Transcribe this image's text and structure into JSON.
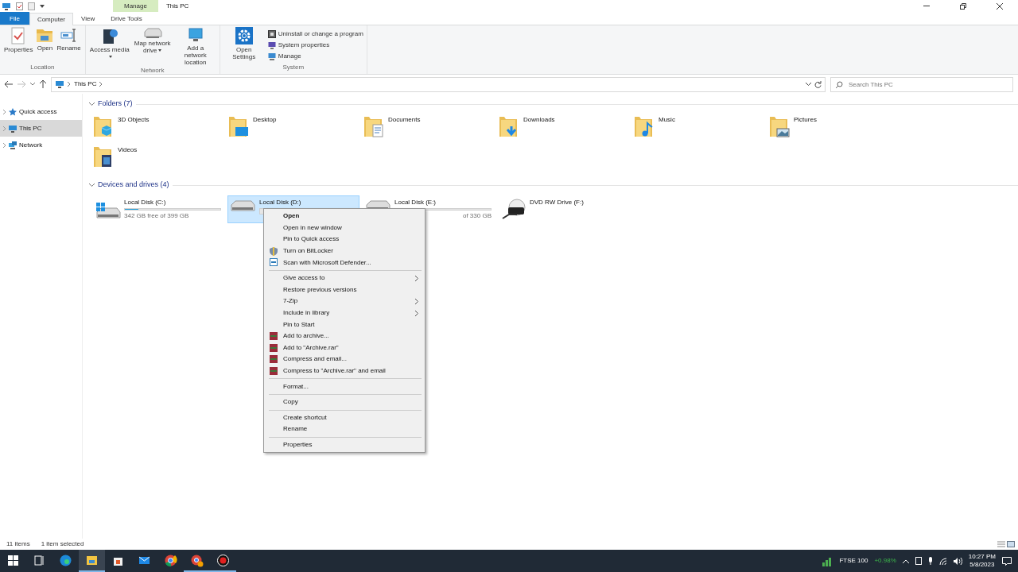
{
  "window": {
    "title": "This PC",
    "contextual_tab": "Manage"
  },
  "ribbon": {
    "tabs": [
      {
        "label": "File",
        "kind": "file",
        "selected": false
      },
      {
        "label": "Computer",
        "kind": "tab",
        "selected": true
      },
      {
        "label": "View",
        "kind": "tab",
        "selected": false
      },
      {
        "label": "Drive Tools",
        "kind": "tab",
        "selected": false
      }
    ],
    "groups": [
      {
        "label": "Location",
        "buttons": [
          {
            "label": "Properties",
            "kind": "properties",
            "dropdown": false
          },
          {
            "label": "Open",
            "kind": "open",
            "dropdown": false
          },
          {
            "label": "Rename",
            "kind": "rename",
            "dropdown": false
          }
        ]
      },
      {
        "label": "Network",
        "buttons": [
          {
            "label": "Access media",
            "kind": "media",
            "dropdown": true
          },
          {
            "label": "Map network drive",
            "kind": "mapdrive",
            "dropdown": true
          },
          {
            "label": "Add a network location",
            "kind": "netloc",
            "dropdown": false
          }
        ]
      },
      {
        "label": "System",
        "buttons": [
          {
            "label": "Open Settings",
            "kind": "settings",
            "dropdown": false
          }
        ],
        "small_buttons": [
          {
            "label": "Uninstall or change a program",
            "kind": "uninstall"
          },
          {
            "label": "System properties",
            "kind": "sysprops"
          },
          {
            "label": "Manage",
            "kind": "manage"
          }
        ]
      }
    ]
  },
  "address": {
    "path": "This PC",
    "search_placeholder": "Search This PC"
  },
  "sidebar": {
    "items": [
      {
        "label": "Quick access",
        "kind": "star",
        "selected": false
      },
      {
        "label": "This PC",
        "kind": "pc",
        "selected": true
      },
      {
        "label": "Network",
        "kind": "network",
        "selected": false
      }
    ]
  },
  "folders": {
    "title": "Folders (7)",
    "items": [
      {
        "label": "3D Objects",
        "kind": "cube"
      },
      {
        "label": "Desktop",
        "kind": "desktop"
      },
      {
        "label": "Documents",
        "kind": "documents"
      },
      {
        "label": "Downloads",
        "kind": "downloads"
      },
      {
        "label": "Music",
        "kind": "music"
      },
      {
        "label": "Pictures",
        "kind": "pictures"
      },
      {
        "label": "Videos",
        "kind": "videos"
      }
    ]
  },
  "drives": {
    "title": "Devices and drives (4)",
    "items": [
      {
        "label": "Local Disk (C:)",
        "kind": "system",
        "selected": false,
        "level": 0.14,
        "free": "342 GB free of 399 GB",
        "cut_start": false
      },
      {
        "label": "Local Disk (D:)",
        "kind": "disk",
        "selected": true,
        "level": 0.0
      },
      {
        "label": "Local Disk (E:)",
        "kind": "disk",
        "selected": false,
        "level": 0.0,
        "free": "of 330 GB",
        "cut_start": true
      },
      {
        "label": "DVD RW Drive (F:)",
        "kind": "optical",
        "selected": false
      }
    ]
  },
  "context_menu": {
    "items": [
      {
        "label": "Open",
        "kind": "default"
      },
      {
        "label": "Open in new window",
        "kind": "plain"
      },
      {
        "label": "Pin to Quick access",
        "kind": "plain"
      },
      {
        "label": "Turn on BitLocker",
        "kind": "shield"
      },
      {
        "label": "Scan with Microsoft Defender...",
        "kind": "scan"
      },
      {
        "kind": "separator"
      },
      {
        "label": "Give access to",
        "kind": "submenu"
      },
      {
        "label": "Restore previous versions",
        "kind": "plain"
      },
      {
        "label": "7-Zip",
        "kind": "submenu"
      },
      {
        "label": "Include in library",
        "kind": "submenu"
      },
      {
        "label": "Pin to Start",
        "kind": "plain"
      },
      {
        "label": "Add to archive...",
        "kind": "archive"
      },
      {
        "label": "Add to \"Archive.rar\"",
        "kind": "archive"
      },
      {
        "label": "Compress and email...",
        "kind": "archive"
      },
      {
        "label": "Compress to \"Archive.rar\" and email",
        "kind": "archive"
      },
      {
        "kind": "separator"
      },
      {
        "label": "Format...",
        "kind": "plain"
      },
      {
        "kind": "separator"
      },
      {
        "label": "Copy",
        "kind": "plain"
      },
      {
        "kind": "separator"
      },
      {
        "label": "Create shortcut",
        "kind": "plain"
      },
      {
        "label": "Rename",
        "kind": "plain"
      },
      {
        "kind": "separator"
      },
      {
        "label": "Properties",
        "kind": "plain"
      }
    ]
  },
  "status_bar": {
    "count": "11 items",
    "selection": "1 item selected"
  },
  "taskbar": {
    "apps": [
      {
        "kind": "start",
        "running": false,
        "selected": false
      },
      {
        "kind": "taskview",
        "running": false,
        "selected": false
      },
      {
        "kind": "edge",
        "running": false,
        "selected": false
      },
      {
        "kind": "explorer",
        "running": true,
        "selected": true
      },
      {
        "kind": "store",
        "running": false,
        "selected": false
      },
      {
        "kind": "mail",
        "running": false,
        "selected": false
      },
      {
        "kind": "chrome",
        "running": false,
        "selected": false
      },
      {
        "kind": "chromeprofile",
        "running": true,
        "selected": false
      },
      {
        "kind": "recorder",
        "running": true,
        "selected": false
      }
    ],
    "widget": {
      "label": "FTSE 100",
      "change": "+0.98%"
    },
    "time": "10:27 PM",
    "date": "5/8/2023"
  }
}
